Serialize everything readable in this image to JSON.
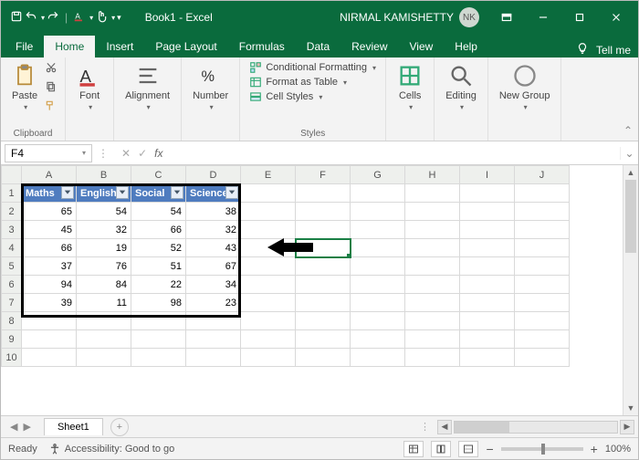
{
  "title": "Book1 - Excel",
  "user": {
    "name": "NIRMAL KAMISHETTY",
    "initials": "NK"
  },
  "tabs": {
    "file": "File",
    "home": "Home",
    "insert": "Insert",
    "pagelayout": "Page Layout",
    "formulas": "Formulas",
    "data": "Data",
    "review": "Review",
    "view": "View",
    "help": "Help",
    "tellme": "Tell me"
  },
  "ribbon": {
    "clipboard": {
      "paste": "Paste",
      "label": "Clipboard"
    },
    "font": {
      "btn": "Font"
    },
    "alignment": {
      "btn": "Alignment"
    },
    "number": {
      "btn": "Number"
    },
    "styles": {
      "cond": "Conditional Formatting",
      "table": "Format as Table",
      "cell": "Cell Styles",
      "label": "Styles"
    },
    "cells": {
      "btn": "Cells"
    },
    "editing": {
      "btn": "Editing"
    },
    "newgroup": {
      "btn": "New\nGroup",
      "label": "New Group"
    }
  },
  "namebox": "F4",
  "columns": [
    "A",
    "B",
    "C",
    "D",
    "E",
    "F",
    "G",
    "H",
    "I",
    "J"
  ],
  "rows": [
    "1",
    "2",
    "3",
    "4",
    "5",
    "6",
    "7",
    "8",
    "9",
    "10"
  ],
  "table": {
    "headers": [
      "Maths",
      "English",
      "Social",
      "Science"
    ],
    "data": [
      [
        65,
        54,
        54,
        38
      ],
      [
        45,
        32,
        66,
        32
      ],
      [
        66,
        19,
        52,
        43
      ],
      [
        37,
        76,
        51,
        67
      ],
      [
        94,
        84,
        22,
        34
      ],
      [
        39,
        11,
        98,
        23
      ]
    ]
  },
  "active_cell": {
    "col": "F",
    "row": 4
  },
  "sheet": {
    "name": "Sheet1"
  },
  "status": {
    "ready": "Ready",
    "accessibility": "Accessibility: Good to go",
    "zoom": "100%"
  }
}
